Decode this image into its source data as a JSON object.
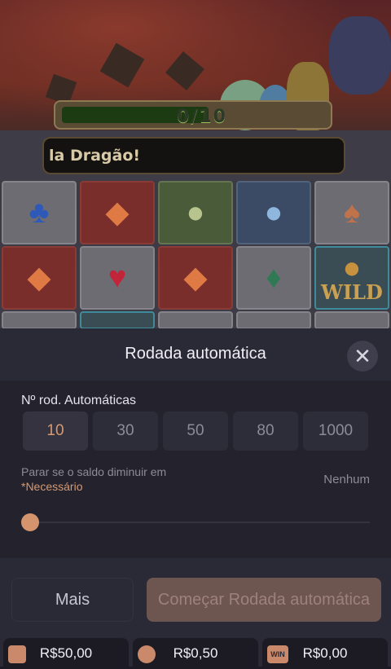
{
  "game": {
    "progress_text": "0/10",
    "banner_text": "la Dragão!",
    "wild_label": "WILD"
  },
  "autospin": {
    "title": "Rodada automática",
    "close_icon": "close-icon",
    "count_label": "Nº rod. Automáticas",
    "options": [
      "10",
      "30",
      "50",
      "80",
      "1000"
    ],
    "selected_option": "10",
    "stop_label": "Parar se o saldo diminuir em",
    "required_label": "*Necessário",
    "stop_value": "Nenhum",
    "slider_value": 0,
    "more_label": "Mais",
    "start_label": "Começar Rodada automática"
  },
  "footer": {
    "balance": "R$50,00",
    "bet": "R$0,50",
    "win": "R$0,00",
    "win_icon_text": "WIN"
  },
  "colors": {
    "accent": "#d49a73",
    "sheet_bg": "#2a2936",
    "start_button_bg": "#6e5650"
  }
}
